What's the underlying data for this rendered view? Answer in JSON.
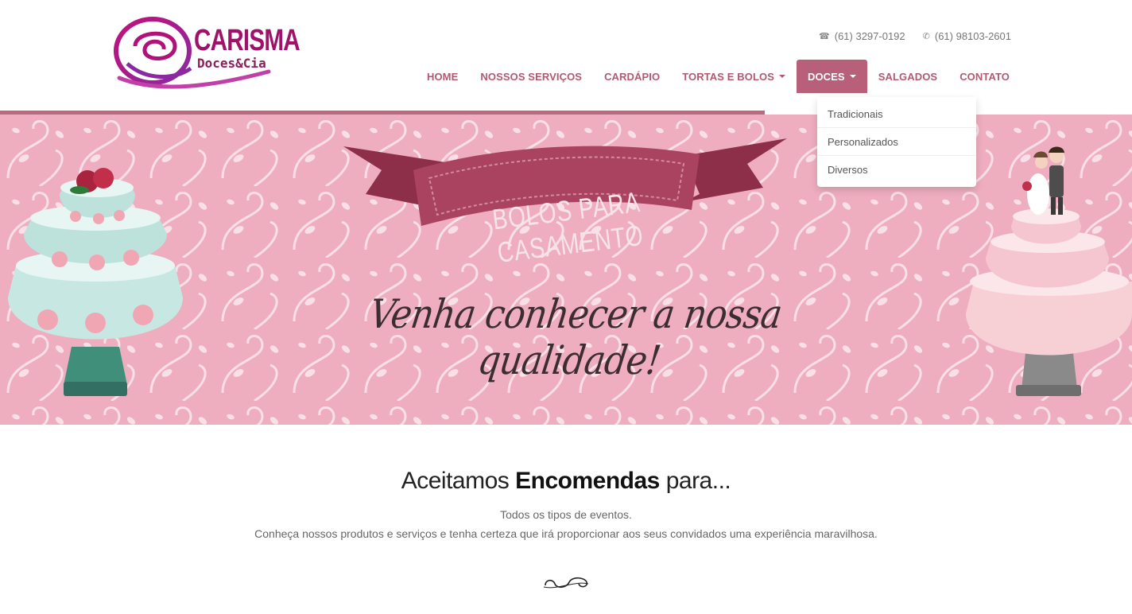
{
  "brand": {
    "name": "CARISMA",
    "sub": "Doces&Cia"
  },
  "contacts": [
    {
      "icon": "phone-icon",
      "text": "(61) 3297-0192"
    },
    {
      "icon": "whatsapp-icon",
      "text": "(61) 98103-2601"
    }
  ],
  "nav": [
    {
      "label": "HOME",
      "dropdown": false,
      "active": false
    },
    {
      "label": "NOSSOS SERVIÇOS",
      "dropdown": false,
      "active": false
    },
    {
      "label": "CARDÁPIO",
      "dropdown": false,
      "active": false
    },
    {
      "label": "TORTAS E BOLOS",
      "dropdown": true,
      "active": false
    },
    {
      "label": "DOCES",
      "dropdown": true,
      "active": true
    },
    {
      "label": "SALGADOS",
      "dropdown": false,
      "active": false
    },
    {
      "label": "CONTATO",
      "dropdown": false,
      "active": false
    }
  ],
  "doces_menu": [
    "Tradicionais",
    "Personalizados",
    "Diversos"
  ],
  "banner": {
    "ribbon": "BOLOS PARA CASAMENTO",
    "tagline": "Venha conhecer a nossa qualidade!"
  },
  "intro": {
    "headline_pre": "Aceitamos ",
    "headline_bold": "Encomendas",
    "headline_post": " para...",
    "line1": "Todos os tipos de eventos.",
    "line2": "Conheça nossos produtos e serviços e tenha certeza que irá proporcionar aos seus convidados uma experiência maravilhosa."
  },
  "colors": {
    "accent": "#b8607a",
    "nav_text": "#b05a72",
    "banner_bg": "#eeaec0",
    "logo": "#a0126a"
  }
}
